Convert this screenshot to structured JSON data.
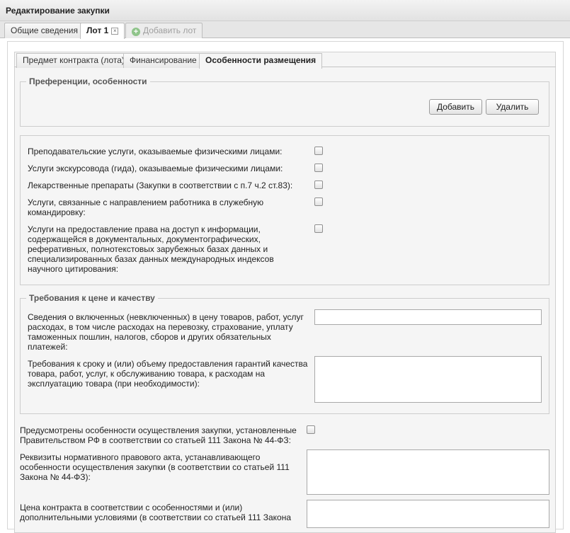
{
  "window": {
    "title": "Редактирование закупки"
  },
  "top_tabs": [
    {
      "label": "Общие сведения"
    },
    {
      "label": "Лот 1"
    },
    {
      "label": "Добавить лот"
    }
  ],
  "sub_tabs": [
    {
      "label": "Предмет контракта (лота)"
    },
    {
      "label": "Финансирование"
    },
    {
      "label": "Особенности размещения"
    }
  ],
  "preferences": {
    "legend": "Преференции, особенности",
    "add_label": "Добавить",
    "delete_label": "Удалить"
  },
  "checkbox_items": [
    {
      "label": "Преподавательские услуги, оказываемые физическими лицами:",
      "checked": false
    },
    {
      "label": "Услуги экскурсовода (гида), оказываемые физическими лицами:",
      "checked": false
    },
    {
      "label": "Лекарственные препараты (Закупки в соответствии с п.7 ч.2 ст.83):",
      "checked": false
    },
    {
      "label": "Услуги, связанные с направлением работника в служебную командировку:",
      "checked": false
    },
    {
      "label": "Услуги на предоставление права на доступ к информации, содержащейся в документальных, документографических, реферативных, полнотекстовых зарубежных базах данных и специализированных базах данных международных индексов научного цитирования:",
      "checked": false
    }
  ],
  "price_quality": {
    "legend": "Требования к цене и качеству",
    "included_label": "Сведения о включенных (невключенных) в цену товаров, работ, услуг расходах, в том числе расходах на перевозку, страхование, уплату таможенных пошлин, налогов, сборов и других обязательных платежей:",
    "included_value": "",
    "guarantee_label": "Требования к сроку и (или) объему предоставления гарантий качества товара, работ, услуг, к обслуживанию товара, к расходам на эксплуатацию товара (при необходимости):",
    "guarantee_value": ""
  },
  "special": {
    "features_label": "Предусмотрены особенности осуществления закупки, установленные Правительством РФ в соответствии со статьей 111 Закона № 44-ФЗ:",
    "features_checked": false,
    "act_label": "Реквизиты нормативного правового акта, устанавливающего особенности осуществления закупки (в соответствии со статьей 111 Закона № 44-ФЗ):",
    "act_value": "",
    "price_label": "Цена контракта в соответствии с особенностями и (или) дополнительными условиями (в соответствии со статьей 111 Закона",
    "price_value": ""
  }
}
